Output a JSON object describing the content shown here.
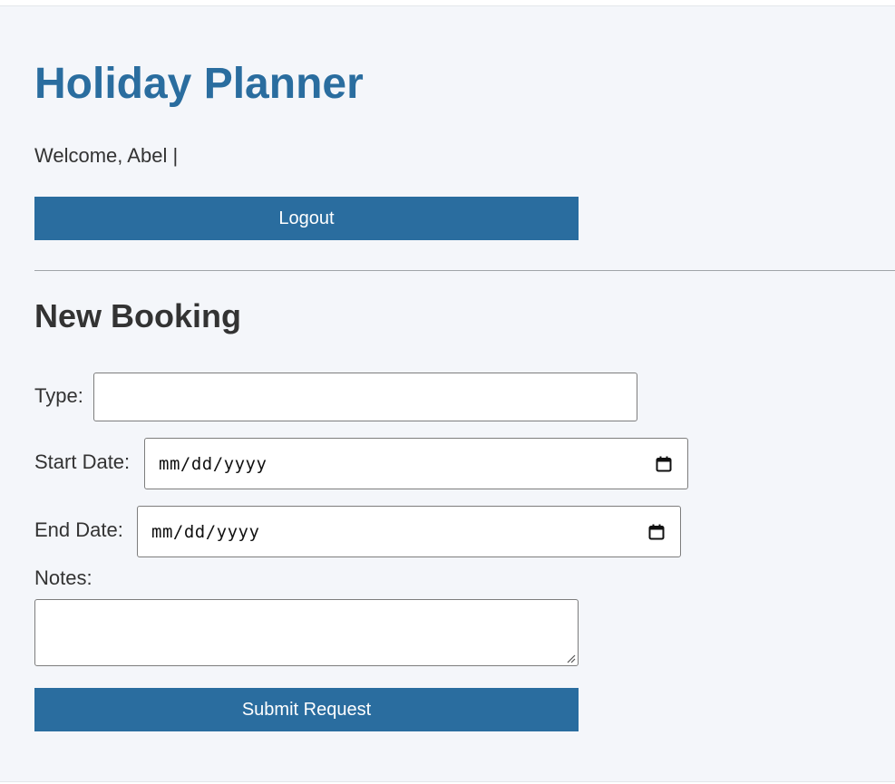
{
  "header": {
    "title": "Holiday Planner",
    "welcome_text": "Welcome, Abel |",
    "logout_label": "Logout"
  },
  "booking_form": {
    "section_title": "New Booking",
    "type": {
      "label": "Type:",
      "value": ""
    },
    "start_date": {
      "label": "Start Date:",
      "placeholder": "mm/dd/yyyy"
    },
    "end_date": {
      "label": "End Date:",
      "placeholder": "mm/dd/yyyy"
    },
    "notes": {
      "label": "Notes:",
      "value": ""
    },
    "submit_label": "Submit Request"
  },
  "icons": {
    "calendar": "calendar-icon",
    "resize": "resize-grip-icon"
  },
  "colors": {
    "accent": "#2a6d9f",
    "background": "#f4f6fa",
    "text": "#333333"
  }
}
